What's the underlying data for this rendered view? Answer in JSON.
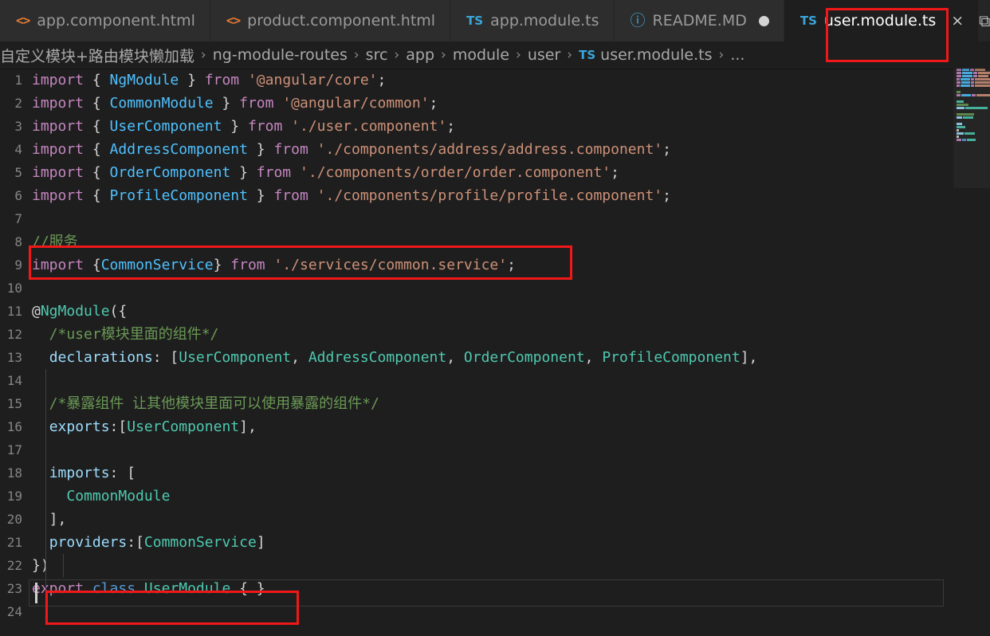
{
  "window": {
    "app": "Visual Studio Code",
    "theme_bg": "#1e1e1e",
    "accent_annotation": "#f01818"
  },
  "tabs": [
    {
      "label": "app.component.html",
      "icon": "html-file-icon",
      "icon_glyph": "<>",
      "active": false,
      "dirty": false
    },
    {
      "label": "product.component.html",
      "icon": "html-file-icon",
      "icon_glyph": "<>",
      "active": false,
      "dirty": false
    },
    {
      "label": "app.module.ts",
      "icon": "typescript-file-icon",
      "icon_glyph": "TS",
      "active": false,
      "dirty": false
    },
    {
      "label": "README.MD",
      "icon": "markdown-info-icon",
      "icon_glyph": "ⓘ",
      "active": false,
      "dirty": true
    },
    {
      "label": "user.module.ts",
      "icon": "typescript-file-icon",
      "icon_glyph": "TS",
      "active": true,
      "dirty": false,
      "close_glyph": "×"
    }
  ],
  "tabbar_actions": [
    {
      "name": "split-editor-icon",
      "glyph": "⧉"
    }
  ],
  "breadcrumb": {
    "items": [
      "自定义模块+路由模块懒加载",
      "ng-module-routes",
      "src",
      "app",
      "module",
      "user",
      "user.module.ts",
      "..."
    ],
    "separator": "›",
    "file_icon_glyph": "TS"
  },
  "editor": {
    "language": "TypeScript",
    "lines": [
      {
        "n": "1",
        "tokens": [
          {
            "t": "import",
            "c": "kw"
          },
          {
            "t": " { ",
            "c": "pun"
          },
          {
            "t": "NgModule",
            "c": "cls"
          },
          {
            "t": " } ",
            "c": "pun"
          },
          {
            "t": "from",
            "c": "kw"
          },
          {
            "t": " ",
            "c": "pun"
          },
          {
            "t": "'@angular/core'",
            "c": "str"
          },
          {
            "t": ";",
            "c": "pun"
          }
        ]
      },
      {
        "n": "2",
        "tokens": [
          {
            "t": "import",
            "c": "kw"
          },
          {
            "t": " { ",
            "c": "pun"
          },
          {
            "t": "CommonModule",
            "c": "cls"
          },
          {
            "t": " } ",
            "c": "pun"
          },
          {
            "t": "from",
            "c": "kw"
          },
          {
            "t": " ",
            "c": "pun"
          },
          {
            "t": "'@angular/common'",
            "c": "str"
          },
          {
            "t": ";",
            "c": "pun"
          }
        ]
      },
      {
        "n": "3",
        "tokens": [
          {
            "t": "import",
            "c": "kw"
          },
          {
            "t": " { ",
            "c": "pun"
          },
          {
            "t": "UserComponent",
            "c": "cls"
          },
          {
            "t": " } ",
            "c": "pun"
          },
          {
            "t": "from",
            "c": "kw"
          },
          {
            "t": " ",
            "c": "pun"
          },
          {
            "t": "'./user.component'",
            "c": "str"
          },
          {
            "t": ";",
            "c": "pun"
          }
        ]
      },
      {
        "n": "4",
        "tokens": [
          {
            "t": "import",
            "c": "kw"
          },
          {
            "t": " { ",
            "c": "pun"
          },
          {
            "t": "AddressComponent",
            "c": "cls"
          },
          {
            "t": " } ",
            "c": "pun"
          },
          {
            "t": "from",
            "c": "kw"
          },
          {
            "t": " ",
            "c": "pun"
          },
          {
            "t": "'./components/address/address.component'",
            "c": "str"
          },
          {
            "t": ";",
            "c": "pun"
          }
        ]
      },
      {
        "n": "5",
        "tokens": [
          {
            "t": "import",
            "c": "kw"
          },
          {
            "t": " { ",
            "c": "pun"
          },
          {
            "t": "OrderComponent",
            "c": "cls"
          },
          {
            "t": " } ",
            "c": "pun"
          },
          {
            "t": "from",
            "c": "kw"
          },
          {
            "t": " ",
            "c": "pun"
          },
          {
            "t": "'./components/order/order.component'",
            "c": "str"
          },
          {
            "t": ";",
            "c": "pun"
          }
        ]
      },
      {
        "n": "6",
        "tokens": [
          {
            "t": "import",
            "c": "kw"
          },
          {
            "t": " { ",
            "c": "pun"
          },
          {
            "t": "ProfileComponent",
            "c": "cls"
          },
          {
            "t": " } ",
            "c": "pun"
          },
          {
            "t": "from",
            "c": "kw"
          },
          {
            "t": " ",
            "c": "pun"
          },
          {
            "t": "'./components/profile/profile.component'",
            "c": "str"
          },
          {
            "t": ";",
            "c": "pun"
          }
        ]
      },
      {
        "n": "7",
        "tokens": []
      },
      {
        "n": "8",
        "tokens": [
          {
            "t": "//服务",
            "c": "cmt"
          }
        ]
      },
      {
        "n": "9",
        "tokens": [
          {
            "t": "import",
            "c": "kw"
          },
          {
            "t": " {",
            "c": "pun"
          },
          {
            "t": "CommonService",
            "c": "cls"
          },
          {
            "t": "} ",
            "c": "pun"
          },
          {
            "t": "from",
            "c": "kw"
          },
          {
            "t": " ",
            "c": "pun"
          },
          {
            "t": "'./services/common.service'",
            "c": "str"
          },
          {
            "t": ";",
            "c": "pun"
          }
        ]
      },
      {
        "n": "10",
        "tokens": []
      },
      {
        "n": "11",
        "tokens": [
          {
            "t": "@",
            "c": "pun"
          },
          {
            "t": "NgModule",
            "c": "dec"
          },
          {
            "t": "({",
            "c": "pun"
          }
        ]
      },
      {
        "n": "12",
        "tokens": [
          {
            "t": "  /*user模块里面的组件*/",
            "c": "cmt"
          }
        ]
      },
      {
        "n": "13",
        "tokens": [
          {
            "t": "  ",
            "c": "pun"
          },
          {
            "t": "declarations",
            "c": "prop"
          },
          {
            "t": ": [",
            "c": "pun"
          },
          {
            "t": "UserComponent",
            "c": "typ"
          },
          {
            "t": ", ",
            "c": "pun"
          },
          {
            "t": "AddressComponent",
            "c": "typ"
          },
          {
            "t": ", ",
            "c": "pun"
          },
          {
            "t": "OrderComponent",
            "c": "typ"
          },
          {
            "t": ", ",
            "c": "pun"
          },
          {
            "t": "ProfileComponent",
            "c": "typ"
          },
          {
            "t": "],",
            "c": "pun"
          }
        ]
      },
      {
        "n": "14",
        "tokens": []
      },
      {
        "n": "15",
        "tokens": [
          {
            "t": "  /*暴露组件 让其他模块里面可以使用暴露的组件*/",
            "c": "cmt"
          }
        ]
      },
      {
        "n": "16",
        "tokens": [
          {
            "t": "  ",
            "c": "pun"
          },
          {
            "t": "exports",
            "c": "prop"
          },
          {
            "t": ":[",
            "c": "pun"
          },
          {
            "t": "UserComponent",
            "c": "typ"
          },
          {
            "t": "],",
            "c": "pun"
          }
        ]
      },
      {
        "n": "17",
        "tokens": []
      },
      {
        "n": "18",
        "tokens": [
          {
            "t": "  ",
            "c": "pun"
          },
          {
            "t": "imports",
            "c": "prop"
          },
          {
            "t": ": [",
            "c": "pun"
          }
        ]
      },
      {
        "n": "19",
        "tokens": [
          {
            "t": "    ",
            "c": "pun"
          },
          {
            "t": "CommonModule",
            "c": "typ"
          }
        ]
      },
      {
        "n": "20",
        "tokens": [
          {
            "t": "  ],",
            "c": "pun"
          }
        ]
      },
      {
        "n": "21",
        "tokens": [
          {
            "t": "  ",
            "c": "pun"
          },
          {
            "t": "providers",
            "c": "prop"
          },
          {
            "t": ":[",
            "c": "pun"
          },
          {
            "t": "CommonService",
            "c": "typ"
          },
          {
            "t": "]",
            "c": "pun"
          }
        ]
      },
      {
        "n": "22",
        "tokens": [
          {
            "t": "})",
            "c": "pun"
          }
        ]
      },
      {
        "n": "23",
        "tokens": [
          {
            "t": "export",
            "c": "kw"
          },
          {
            "t": " ",
            "c": "pun"
          },
          {
            "t": "class",
            "c": "kw2"
          },
          {
            "t": " ",
            "c": "pun"
          },
          {
            "t": "UserModule",
            "c": "typ"
          },
          {
            "t": " { }",
            "c": "pun"
          }
        ]
      },
      {
        "n": "24",
        "tokens": []
      }
    ]
  },
  "annotations": [
    {
      "name": "annotation-active-tab",
      "target": "user.module.ts tab"
    },
    {
      "name": "annotation-import-service",
      "target": "import {CommonService} from './services/common.service';"
    },
    {
      "name": "annotation-providers",
      "target": "providers:[CommonService]"
    }
  ],
  "minimap": {
    "name": "code-minimap",
    "rows": [
      [
        [
          "#c586c0",
          9
        ],
        [
          "#4fc1ff",
          16
        ],
        [
          "#c586c0",
          8
        ],
        [
          "#ce9178",
          20
        ]
      ],
      [
        [
          "#c586c0",
          9
        ],
        [
          "#4fc1ff",
          22
        ],
        [
          "#c586c0",
          8
        ],
        [
          "#ce9178",
          24
        ]
      ],
      [
        [
          "#c586c0",
          9
        ],
        [
          "#4fc1ff",
          21
        ],
        [
          "#c586c0",
          8
        ],
        [
          "#ce9178",
          22
        ]
      ],
      [
        [
          "#c586c0",
          9
        ],
        [
          "#4fc1ff",
          25
        ],
        [
          "#c586c0",
          8
        ],
        [
          "#ce9178",
          40
        ]
      ],
      [
        [
          "#c586c0",
          9
        ],
        [
          "#4fc1ff",
          23
        ],
        [
          "#c586c0",
          8
        ],
        [
          "#ce9178",
          38
        ]
      ],
      [
        [
          "#c586c0",
          9
        ],
        [
          "#4fc1ff",
          25
        ],
        [
          "#c586c0",
          8
        ],
        [
          "#ce9178",
          40
        ]
      ],
      [],
      [
        [
          "#6a9955",
          8
        ]
      ],
      [
        [
          "#c586c0",
          9
        ],
        [
          "#4fc1ff",
          21
        ],
        [
          "#c586c0",
          8
        ],
        [
          "#ce9178",
          30
        ]
      ],
      [],
      [
        [
          "#4ec9b0",
          14
        ]
      ],
      [
        [
          "#6a9955",
          24
        ]
      ],
      [
        [
          "#9cdcfe",
          16
        ],
        [
          "#4ec9b0",
          46
        ]
      ],
      [],
      [
        [
          "#6a9955",
          36
        ]
      ],
      [
        [
          "#9cdcfe",
          12
        ],
        [
          "#4ec9b0",
          20
        ]
      ],
      [],
      [
        [
          "#9cdcfe",
          12
        ]
      ],
      [
        [
          "#4ec9b0",
          18
        ]
      ],
      [
        [
          "#d4d4d4",
          5
        ]
      ],
      [
        [
          "#9cdcfe",
          14
        ],
        [
          "#4ec9b0",
          22
        ]
      ],
      [
        [
          "#d4d4d4",
          5
        ]
      ],
      [
        [
          "#c586c0",
          9
        ],
        [
          "#569cd6",
          8
        ],
        [
          "#4ec9b0",
          18
        ]
      ]
    ]
  }
}
